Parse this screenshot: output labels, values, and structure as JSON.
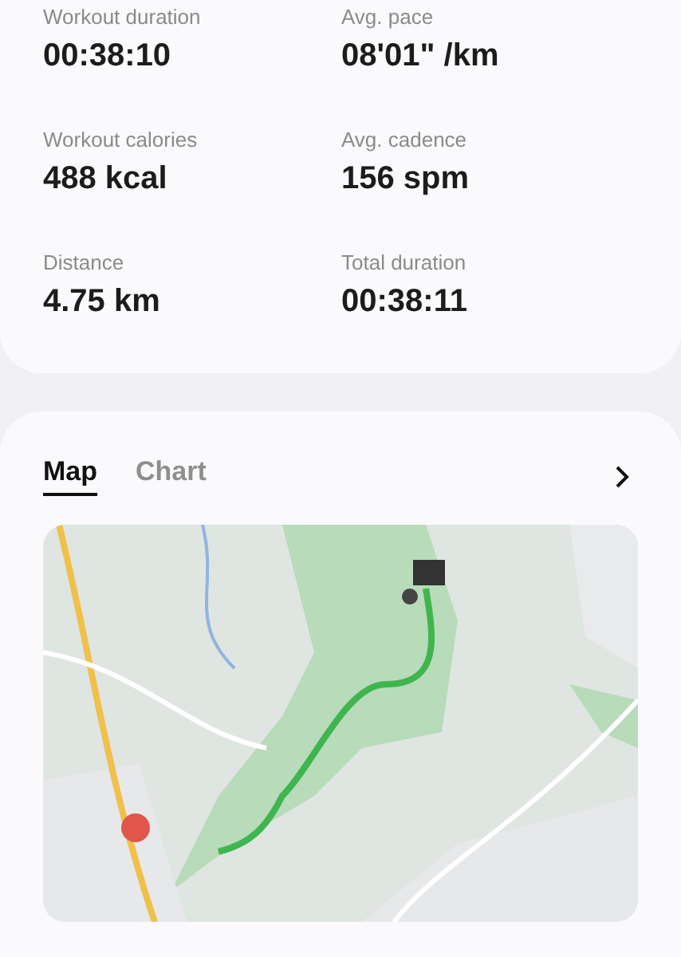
{
  "stats": [
    {
      "label": "Workout duration",
      "value": "00:38:10"
    },
    {
      "label": "Avg. pace",
      "value": "08'01\" /km"
    },
    {
      "label": "Workout calories",
      "value": "488 kcal"
    },
    {
      "label": "Avg. cadence",
      "value": "156 spm"
    },
    {
      "label": "Distance",
      "value": "4.75 km"
    },
    {
      "label": "Total duration",
      "value": "00:38:11"
    }
  ],
  "tabs": [
    {
      "label": "Map",
      "selected": true
    },
    {
      "label": "Chart",
      "selected": false
    }
  ]
}
